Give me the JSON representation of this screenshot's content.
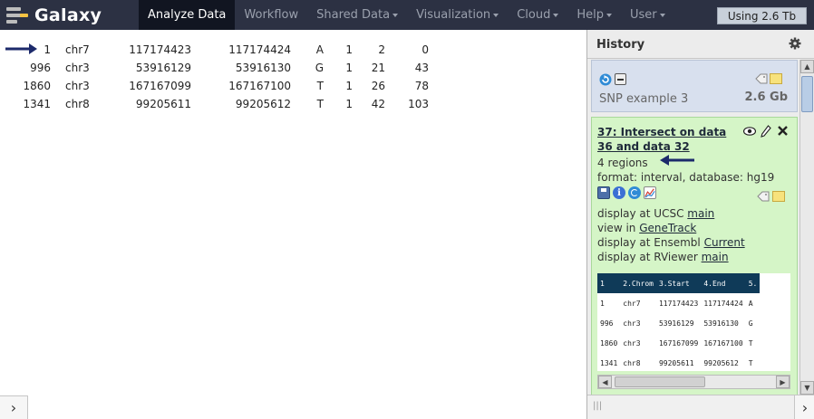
{
  "masthead": {
    "brand": "Galaxy",
    "tabs": [
      {
        "label": "Analyze Data",
        "active": true,
        "dropdown": false
      },
      {
        "label": "Workflow",
        "active": false,
        "dropdown": false
      },
      {
        "label": "Shared Data",
        "active": false,
        "dropdown": true
      },
      {
        "label": "Visualization",
        "active": false,
        "dropdown": true
      },
      {
        "label": "Cloud",
        "active": false,
        "dropdown": true
      },
      {
        "label": "Help",
        "active": false,
        "dropdown": true
      },
      {
        "label": "User",
        "active": false,
        "dropdown": true
      }
    ],
    "quota": "Using 2.6 Tb"
  },
  "center": {
    "rows": [
      [
        "1",
        "chr7",
        "117174423",
        "117174424",
        "A",
        "1",
        "2",
        "0"
      ],
      [
        "996",
        "chr3",
        "53916129",
        "53916130",
        "G",
        "1",
        "21",
        "43"
      ],
      [
        "1860",
        "chr3",
        "167167099",
        "167167100",
        "T",
        "1",
        "26",
        "78"
      ],
      [
        "1341",
        "chr8",
        "99205611",
        "99205612",
        "T",
        "1",
        "42",
        "103"
      ]
    ],
    "toggle": "›"
  },
  "history": {
    "title": "History",
    "name": "SNP example 3",
    "size": "2.6 Gb",
    "dataset": {
      "title": "37: Intersect on data 36 and data 32",
      "regions": "4 regions",
      "format": "format: interval, database: hg19",
      "links": [
        {
          "prefix": "display at UCSC ",
          "link": "main"
        },
        {
          "prefix": "view in ",
          "link": "GeneTrack"
        },
        {
          "prefix": "display at Ensembl ",
          "link": "Current"
        },
        {
          "prefix": "display at RViewer ",
          "link": "main"
        }
      ],
      "peek": {
        "headers": [
          "1",
          "2.Chrom",
          "3.Start",
          "4.End",
          "5."
        ],
        "rows": [
          [
            "1",
            "chr7",
            "117174423",
            "117174424",
            "A"
          ],
          [
            "996",
            "chr3",
            "53916129",
            "53916130",
            "G"
          ],
          [
            "1860",
            "chr3",
            "167167099",
            "167167100",
            "T"
          ],
          [
            "1341",
            "chr8",
            "99205611",
            "99205612",
            "T"
          ]
        ]
      }
    },
    "toggle": "›"
  },
  "colors": {
    "masthead": "#2c3143",
    "active_tab": "#111521",
    "dataset_ok": "#d5f5c7",
    "history_info": "#d8e0ee",
    "peek_header": "#0f3a58",
    "arrow": "#1c2a6b"
  }
}
